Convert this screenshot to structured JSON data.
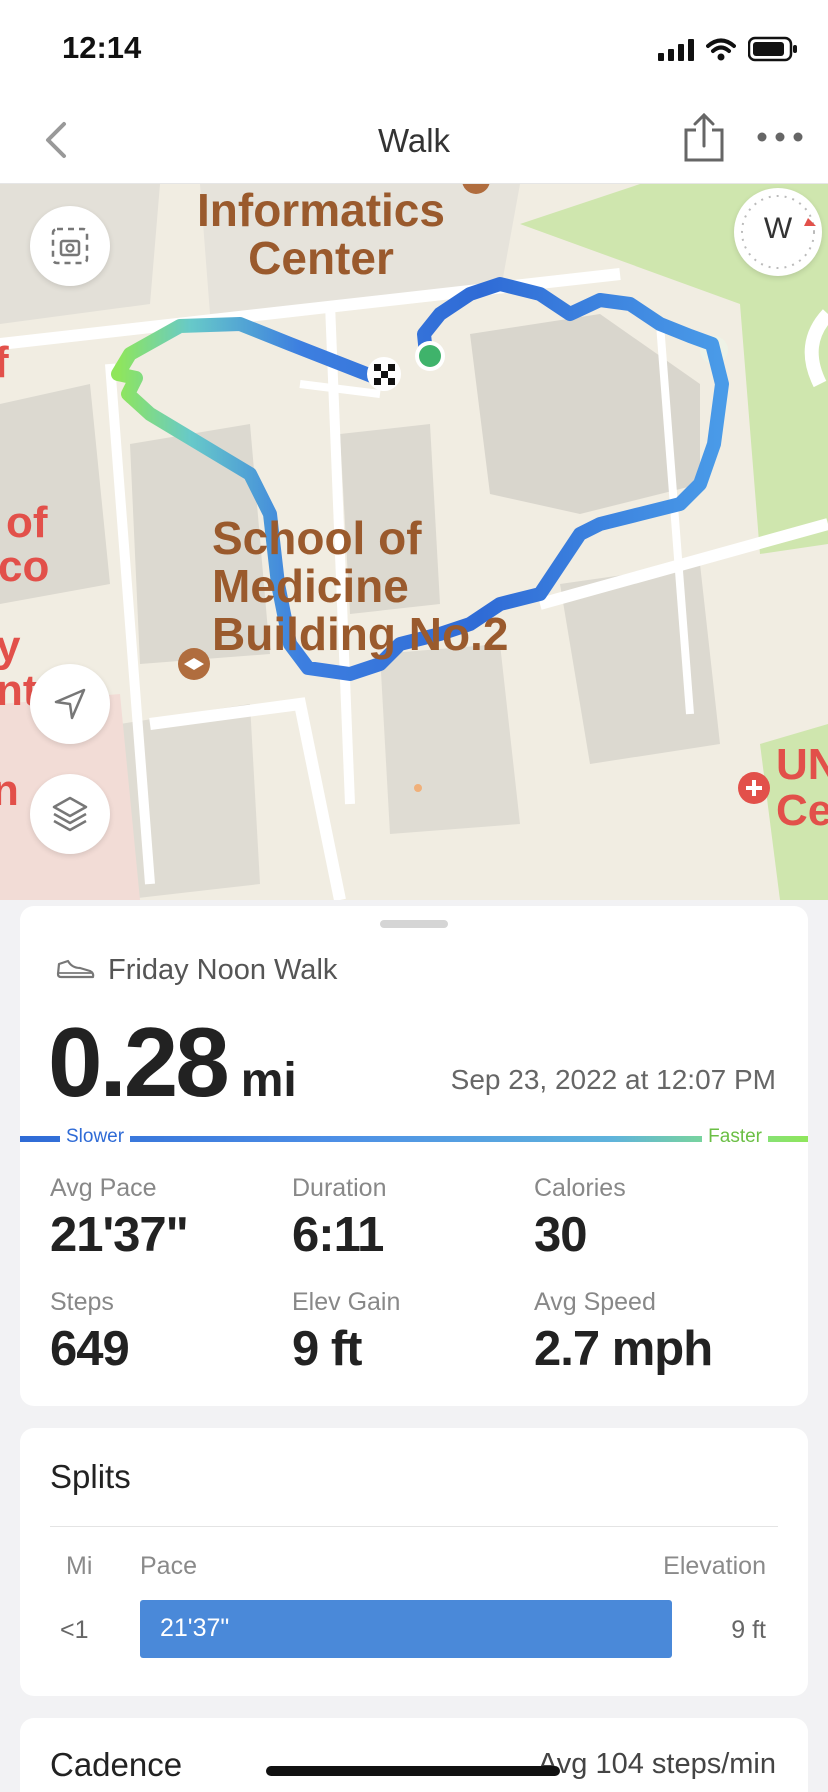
{
  "status_bar": {
    "time": "12:14"
  },
  "nav": {
    "title": "Walk"
  },
  "map": {
    "labels": {
      "informatics": "Informatics\nCenter",
      "school": "School of\nMedicine\nBuilding No.2",
      "left_fragments": [
        "f",
        "of",
        "co",
        "y",
        "nt",
        "n"
      ],
      "right_fragments": [
        "UN",
        "Ce"
      ]
    },
    "compass_label": "W"
  },
  "summary": {
    "activity_name": "Friday Noon Walk",
    "distance_value": "0.28",
    "distance_unit": "mi",
    "datetime": "Sep 23, 2022 at 12:07 PM",
    "pace_legend": {
      "slower": "Slower",
      "faster": "Faster"
    },
    "stats": [
      {
        "label": "Avg Pace",
        "value": "21'37\""
      },
      {
        "label": "Duration",
        "value": "6:11"
      },
      {
        "label": "Calories",
        "value": "30"
      },
      {
        "label": "Steps",
        "value": "649"
      },
      {
        "label": "Elev Gain",
        "value": "9 ft"
      },
      {
        "label": "Avg Speed",
        "value": "2.7 mph"
      }
    ]
  },
  "splits": {
    "title": "Splits",
    "headers": {
      "mi": "Mi",
      "pace": "Pace",
      "elevation": "Elevation"
    },
    "rows": [
      {
        "mi": "<1",
        "pace": "21'37\"",
        "elevation": "9 ft",
        "pace_fraction": 1.0
      }
    ]
  },
  "cadence": {
    "title": "Cadence",
    "avg": "Avg 104 steps/min"
  },
  "colors": {
    "route_slow": "#2f6bd6",
    "route_fast": "#8fe65b",
    "split_bar": "#4a89d9",
    "map_label": "#9a5a2d",
    "start_dot": "#3fb36b"
  }
}
